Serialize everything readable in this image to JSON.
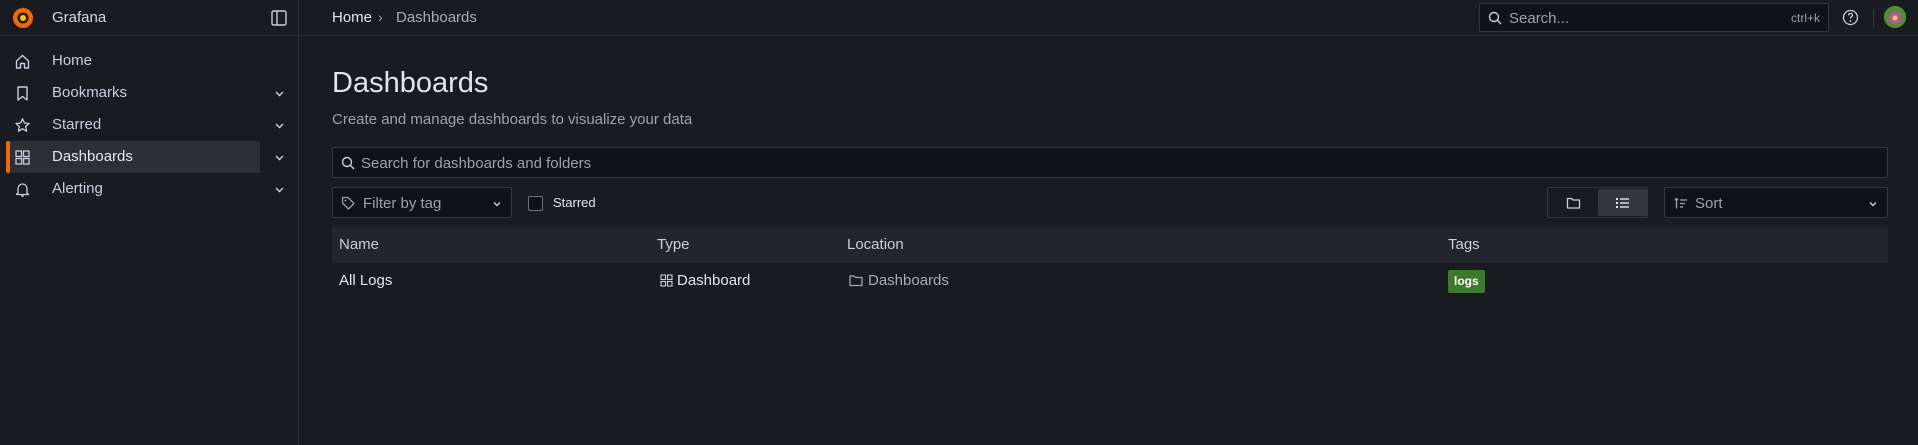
{
  "app": {
    "name": "Grafana",
    "brand_color": "#f46800"
  },
  "sidebar": {
    "items": [
      {
        "label": "Home",
        "icon": "home-icon",
        "expandable": false,
        "active": false
      },
      {
        "label": "Bookmarks",
        "icon": "bookmark-icon",
        "expandable": true,
        "active": false
      },
      {
        "label": "Starred",
        "icon": "star-icon",
        "expandable": true,
        "active": false
      },
      {
        "label": "Dashboards",
        "icon": "apps-icon",
        "expandable": true,
        "active": true
      },
      {
        "label": "Alerting",
        "icon": "bell-icon",
        "expandable": true,
        "active": false
      }
    ],
    "active_color": "#f46800"
  },
  "topbar": {
    "breadcrumb": {
      "home": "Home",
      "separator": "›",
      "current": "Dashboards"
    },
    "search": {
      "placeholder": "Search...",
      "shortcut": "ctrl+k"
    }
  },
  "page": {
    "title": "Dashboards",
    "description": "Create and manage dashboards to visualize your data",
    "search_placeholder": "Search for dashboards and folders",
    "filter_tag_label": "Filter by tag",
    "starred_label": "Starred",
    "starred_checked": false,
    "view_mode": "list",
    "sort_label": "Sort"
  },
  "table": {
    "columns": [
      "Name",
      "Type",
      "Location",
      "Tags"
    ],
    "rows": [
      {
        "name": "All Logs",
        "type": "Dashboard",
        "location": "Dashboards",
        "tags": [
          "logs"
        ]
      }
    ],
    "tag_color": "#3d7a2d"
  }
}
